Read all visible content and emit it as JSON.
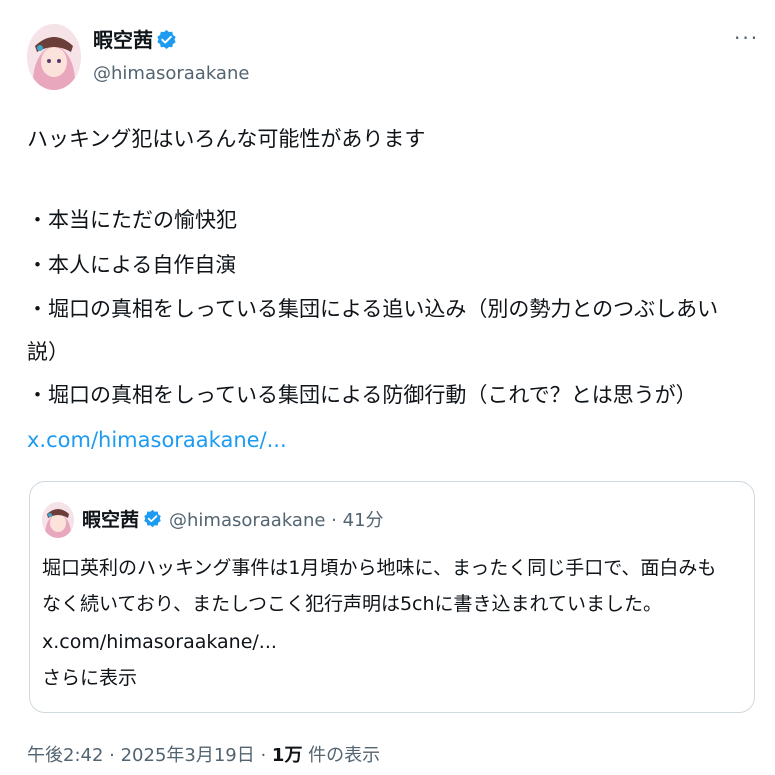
{
  "author": {
    "display_name": "暇空茜",
    "handle": "@himasoraakane",
    "avatar_icon": "avatar-image",
    "verified_icon": "verified-badge-icon"
  },
  "more_label": "···",
  "tweet": {
    "lines": [
      "ハッキング犯はいろんな可能性があります",
      "・本当にただの愉快犯",
      "・本人による自作自演",
      "・堀口の真相をしっている集団による追い込み（別の勢力とのつぶしあい",
      "説）",
      "・堀口の真相をしっている集団による防御行動（これで？とは思うが）"
    ],
    "link": "x.com/himasoraakane/..."
  },
  "quote": {
    "display_name": "暇空茜",
    "handle_time": "@himasoraakane · 41分",
    "lines": [
      "堀口英利のハッキング事件は1月頃から地味に、まったく同じ手口で、面白みも",
      "なく続いており、またしつこく犯行声明は5chに書き込まれていました。"
    ],
    "link": "x.com/himasoraakane/...",
    "show_more": "さらに表示"
  },
  "footer": {
    "time_date": "午後2:42 · 2025年3月19日 · ",
    "views_count": "1万",
    "views_label": " 件の表示"
  },
  "colors": {
    "link": "#1d9bf0",
    "secondary": "#536471",
    "text": "#0f1419",
    "border": "#cfd9de"
  }
}
